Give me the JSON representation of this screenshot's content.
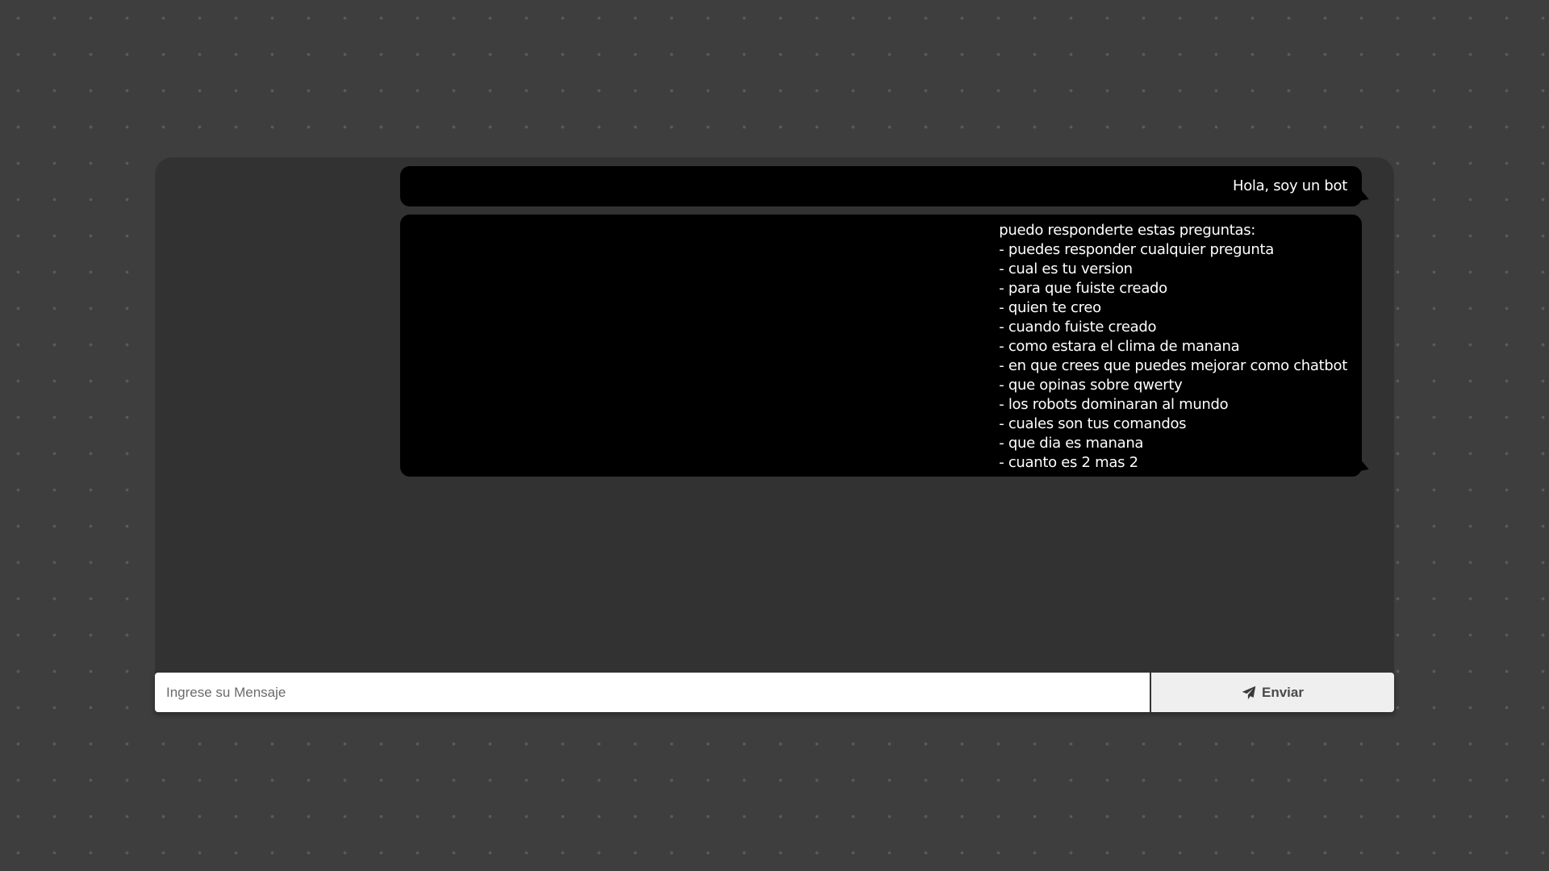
{
  "chat": {
    "messages": [
      {
        "text": "Hola, soy un bot"
      },
      {
        "lines": [
          "puedo responderte estas preguntas:",
          "- puedes responder cualquier pregunta",
          "- cual es tu version",
          "- para que fuiste creado",
          "- quien te creo",
          "- cuando fuiste creado",
          "- como estara el clima de manana",
          "- en que crees que puedes mejorar como chatbot",
          "- que opinas sobre qwerty",
          "- los robots dominaran al mundo",
          "- cuales son tus comandos",
          "- que dia es manana",
          "- cuanto es 2 mas 2"
        ]
      }
    ]
  },
  "input": {
    "placeholder": "Ingrese su Mensaje",
    "value": ""
  },
  "send_button": {
    "label": "Enviar",
    "icon": "paper-plane-icon"
  },
  "colors": {
    "page_background": "#3e3e3e",
    "panel_background": "#323232",
    "bubble_background": "#000000",
    "bubble_text": "#ffffff",
    "button_background": "#efefef"
  }
}
